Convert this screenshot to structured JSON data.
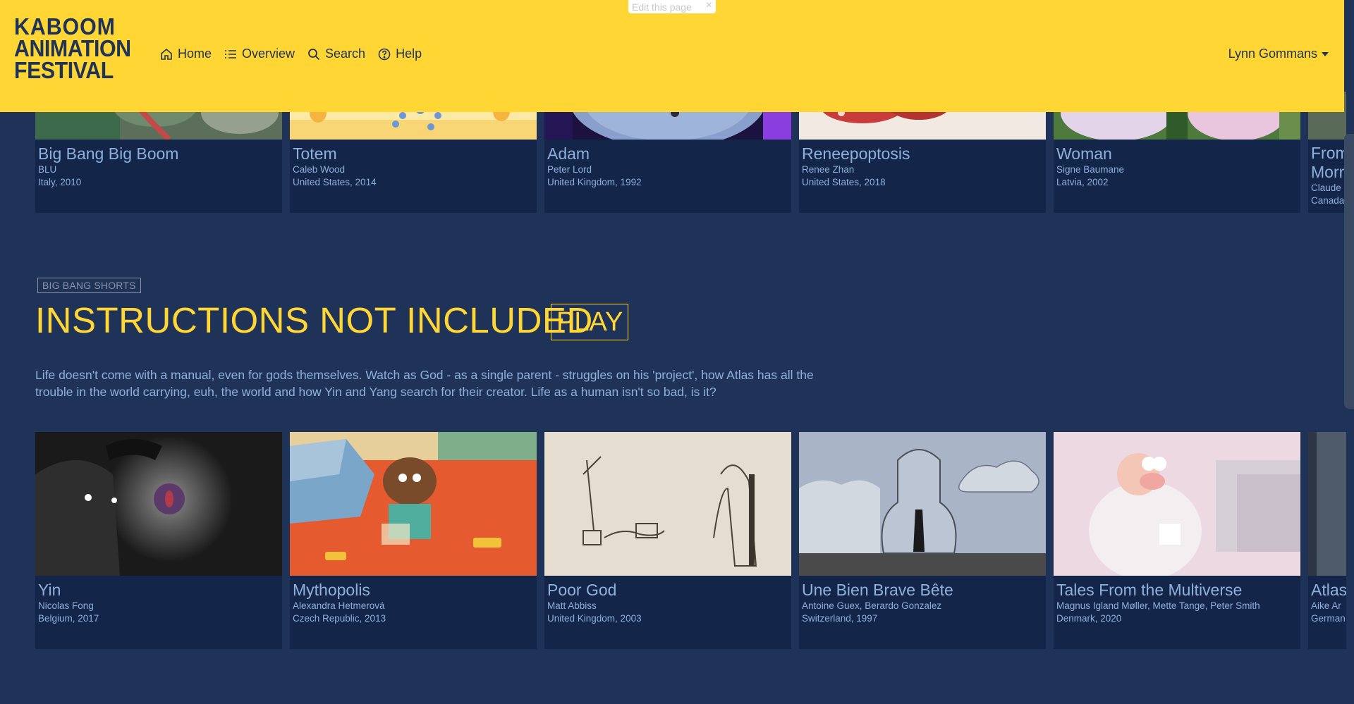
{
  "header": {
    "logo_line1": "KABOOM",
    "logo_line2": "ANIMATION",
    "logo_line3": "FESTIVAL",
    "nav": [
      {
        "label": "Home",
        "icon": "home-icon"
      },
      {
        "label": "Overview",
        "icon": "list-icon"
      },
      {
        "label": "Search",
        "icon": "search-icon"
      },
      {
        "label": "Help",
        "icon": "help-icon"
      }
    ],
    "user": "Lynn Gommans",
    "edit_badge": "Edit this page",
    "edit_close": "×"
  },
  "top_row": [
    {
      "title": "Big Bang Big Boom",
      "director": "BLU",
      "origin": "Italy, 2010"
    },
    {
      "title": "Totem",
      "director": "Caleb Wood",
      "origin": "United States, 2014"
    },
    {
      "title": "Adam",
      "director": "Peter Lord",
      "origin": "United Kingdom, 1992"
    },
    {
      "title": "Reneepoptosis",
      "director": "Renee Zhan",
      "origin": "United States, 2018"
    },
    {
      "title": "Woman",
      "director": "Signe Baumane",
      "origin": "Latvia, 2002"
    },
    {
      "title": "From Morr",
      "director": "Claude",
      "origin": "Canada"
    }
  ],
  "section": {
    "tag": "BIG BANG SHORTS",
    "title": "INSTRUCTIONS NOT INCLUDED",
    "play": "PLAY",
    "description": "Life doesn't come with a manual, even for gods themselves. Watch as God - as a single parent - struggles on his 'project', how Atlas has all the trouble in the world carrying, euh, the world and how Yin and Yang search for their creator. Life as a human isn't so bad, is it?"
  },
  "bottom_row": [
    {
      "title": "Yin",
      "director": "Nicolas Fong",
      "origin": "Belgium, 2017"
    },
    {
      "title": "Mythopolis",
      "director": "Alexandra Hetmerová",
      "origin": "Czech Republic, 2013"
    },
    {
      "title": "Poor God",
      "director": "Matt Abbiss",
      "origin": "United Kingdom, 2003"
    },
    {
      "title": "Une Bien Brave Bête",
      "director": "Antoine Guex, Berardo Gonzalez",
      "origin": "Switzerland, 1997"
    },
    {
      "title": "Tales From the Multiverse",
      "director": "Magnus Igland Møller, Mette Tange, Peter Smith",
      "origin": "Denmark, 2020"
    },
    {
      "title": "Atlas",
      "director": "Aike Ar",
      "origin": "German"
    }
  ],
  "colors": {
    "background": "#1f3358",
    "header": "#ffd633",
    "accent": "#ffd633",
    "card": "#14254a",
    "card_text": "#8fb0d9"
  }
}
